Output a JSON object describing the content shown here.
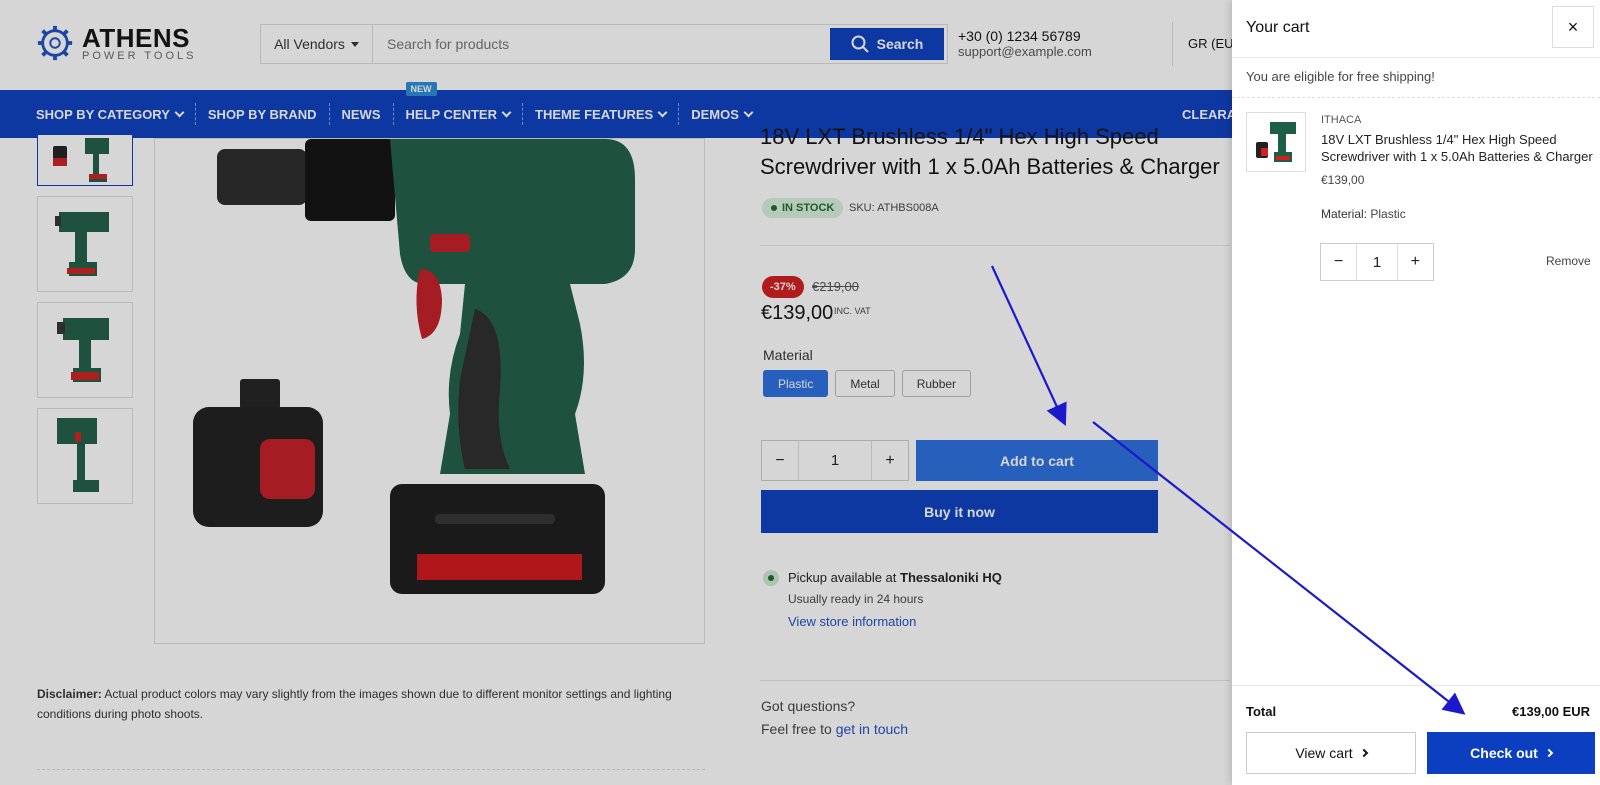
{
  "header": {
    "logo_title": "ATHENS",
    "logo_subtitle": "POWER TOOLS",
    "vendor_select": "All Vendors",
    "search_placeholder": "Search for products",
    "search_button": "Search",
    "phone": "+30 (0) 1234 56789",
    "email": "support@example.com",
    "language": "GR (EUR"
  },
  "nav": {
    "items": [
      {
        "label": "SHOP BY CATEGORY"
      },
      {
        "label": "SHOP BY BRAND"
      },
      {
        "label": "NEWS"
      },
      {
        "label": "HELP CENTER",
        "badge": "NEW"
      },
      {
        "label": "THEME FEATURES"
      },
      {
        "label": "DEMOS"
      }
    ],
    "right_item": "CLEARA"
  },
  "product": {
    "title": "18V LXT Brushless 1/4\" Hex High Speed Screwdriver with 1 x 5.0Ah Batteries & Charger",
    "stock": "IN STOCK",
    "sku": "SKU: ATHBS008A",
    "discount": "-37%",
    "old_price": "€219,00",
    "price": "€139,00",
    "inc_vat": "INC. VAT",
    "material_label": "Material",
    "materials": [
      "Plastic",
      "Metal",
      "Rubber"
    ],
    "selected_material": "Plastic",
    "quantity": "1",
    "add_to_cart": "Add to cart",
    "buy_now": "Buy it now",
    "pickup_prefix": "Pickup available at ",
    "pickup_location": "Thessaloniki HQ",
    "ready_text": "Usually ready in 24 hours",
    "store_link": "View store information",
    "disclaimer_label": "Disclaimer:",
    "disclaimer_text": " Actual product colors may vary slightly from the images shown due to different monitor settings and lighting conditions during photo shoots.",
    "questions": "Got questions?",
    "touch_prefix": "Feel free to ",
    "touch_link": "get in touch"
  },
  "cart": {
    "title": "Your cart",
    "close": "×",
    "free_shipping": "You are eligible for free shipping!",
    "item": {
      "vendor": "ITHACA",
      "name": "18V LXT Brushless 1/4\" Hex High Speed Screwdriver with 1 x 5.0Ah Batteries & Charger",
      "price": "€139,00",
      "material_label": "Material:",
      "material_value": "Plastic",
      "quantity": "1",
      "remove": "Remove"
    },
    "total_label": "Total",
    "total_value": "€139,00 EUR",
    "view_cart": "View cart",
    "check_out": "Check out"
  },
  "colors": {
    "brand_blue": "#0b3fbf",
    "button_blue": "#2a6ee0",
    "sale_red": "#d11b1b",
    "annotation_arrow": "#1a1acc"
  }
}
